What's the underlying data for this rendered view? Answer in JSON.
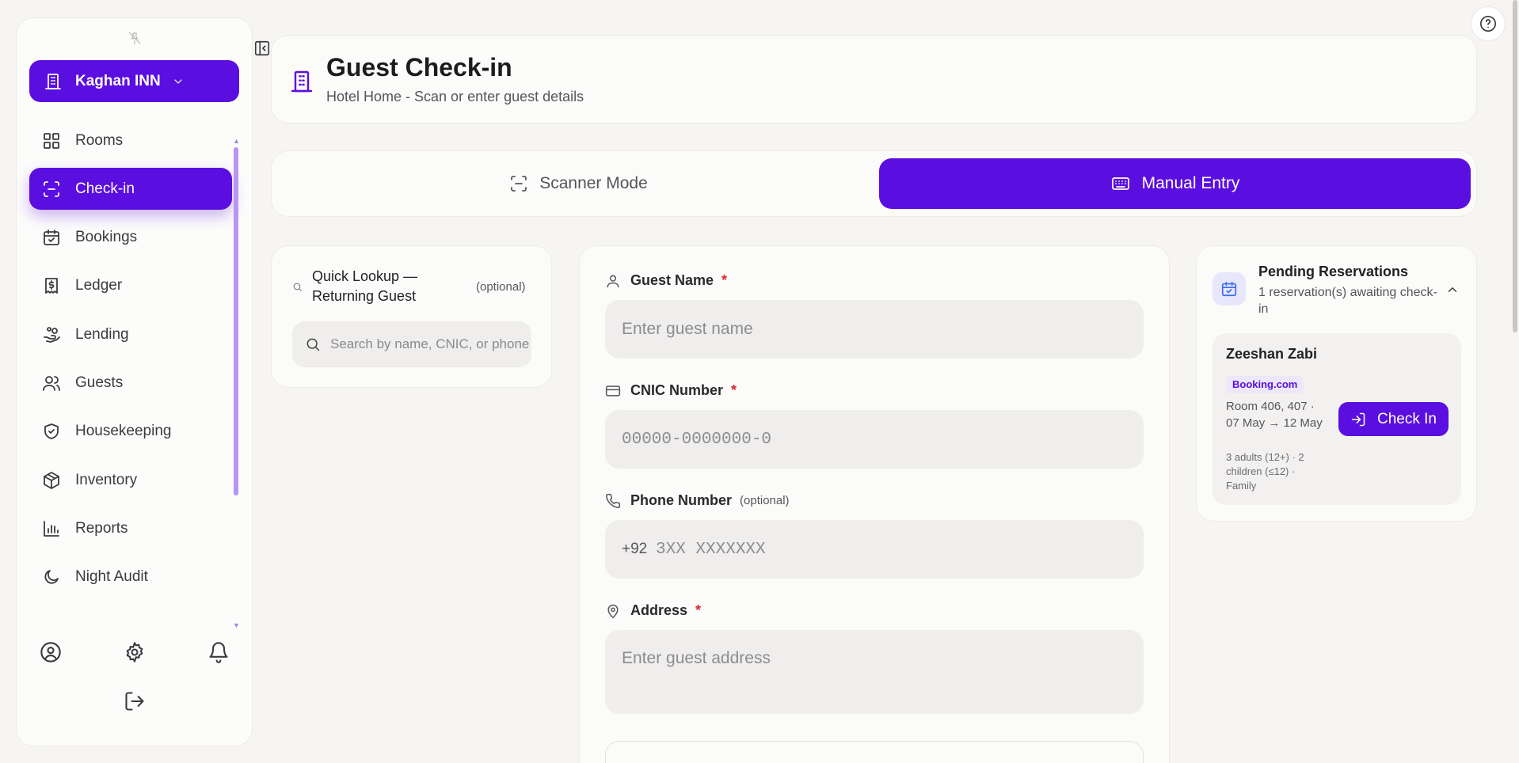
{
  "sidebar": {
    "brand": "Kaghan INN",
    "items": [
      {
        "label": "Rooms",
        "icon": "grid-icon"
      },
      {
        "label": "Check-in",
        "icon": "scan-icon",
        "active": true
      },
      {
        "label": "Bookings",
        "icon": "calendar-check-icon"
      },
      {
        "label": "Ledger",
        "icon": "receipt-icon"
      },
      {
        "label": "Lending",
        "icon": "hand-coins-icon"
      },
      {
        "label": "Guests",
        "icon": "users-icon"
      },
      {
        "label": "Housekeeping",
        "icon": "shield-icon"
      },
      {
        "label": "Inventory",
        "icon": "package-icon"
      },
      {
        "label": "Reports",
        "icon": "bar-chart-icon"
      },
      {
        "label": "Night Audit",
        "icon": "moon-icon"
      }
    ]
  },
  "header": {
    "title": "Guest Check-in",
    "subtitle": "Hotel Home - Scan or enter guest details"
  },
  "modes": {
    "scanner": "Scanner Mode",
    "manual": "Manual Entry",
    "active": "manual"
  },
  "lookup": {
    "title": "Quick Lookup — Returning Guest",
    "optional": "(optional)",
    "placeholder": "Search by name, CNIC, or phone"
  },
  "form": {
    "guest_name": {
      "label": "Guest Name",
      "required": "*",
      "placeholder": "Enter guest name"
    },
    "cnic": {
      "label": "CNIC Number",
      "required": "*",
      "placeholder": "00000-0000000-0"
    },
    "phone": {
      "label": "Phone Number",
      "optional": "(optional)",
      "prefix": "+92",
      "placeholder": "3XX XXXXXXX"
    },
    "address": {
      "label": "Address",
      "required": "*",
      "placeholder": "Enter guest address"
    }
  },
  "pending": {
    "title": "Pending Reservations",
    "subtitle": "1 reservation(s) awaiting check-in",
    "reservations": [
      {
        "guest": "Zeeshan Zabi",
        "source": "Booking.com",
        "details": "Room 406, 407 · 07 May → 12 May",
        "guests": "3 adults (12+) · 2 children (≤12) · Family",
        "action": "Check In"
      }
    ]
  },
  "colors": {
    "accent": "#5b0ee0",
    "required": "#d92a2a",
    "background": "#f6f5f3"
  }
}
